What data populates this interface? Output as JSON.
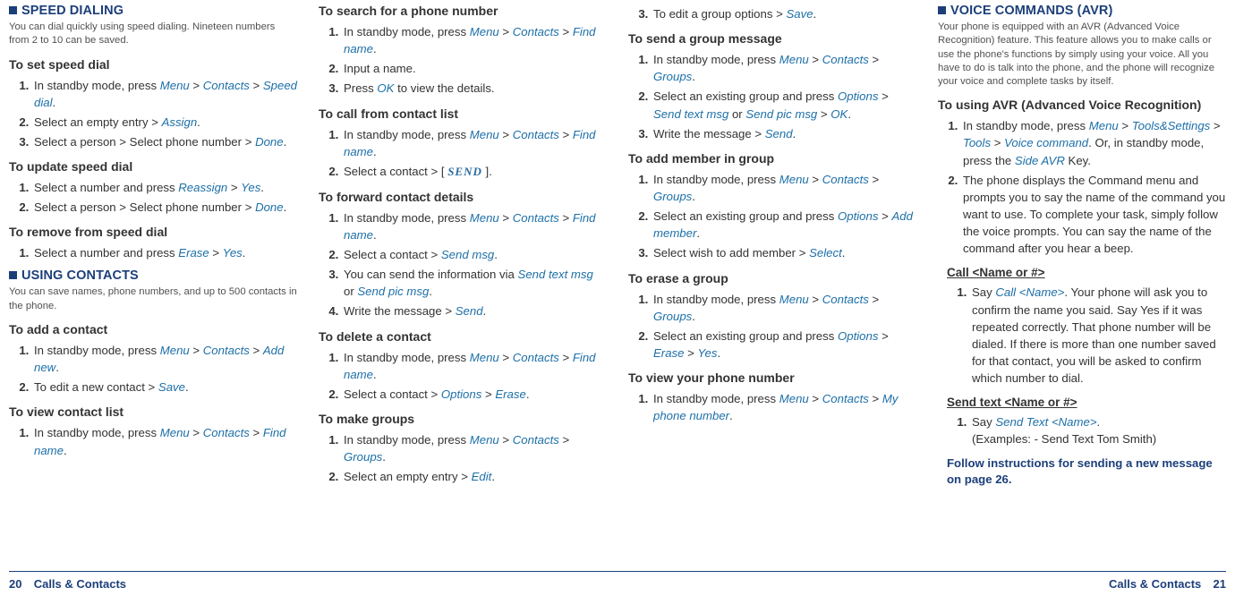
{
  "footer": {
    "left_page": "20",
    "right_page": "21",
    "section": "Calls & Contacts"
  },
  "col1": {
    "sec1": {
      "title": "SPEED DIALING",
      "desc": "You can dial quickly using speed dialing. Nineteen numbers from 2 to 10 can be saved.",
      "sub1": "To set speed dial",
      "li1a": "In standby mode, press ",
      "li1b": "Select an empty entry > ",
      "li1c": "Select a person > Select phone number > ",
      "sub2": "To update speed dial",
      "li2a": "Select a number and press ",
      "li2b": "Select a person > Select phone number > ",
      "sub3": "To remove from speed dial",
      "li3a": "Select a number and press "
    },
    "sec2": {
      "title": "USING CONTACTS",
      "desc": "You can save names, phone numbers, and up to 500 contacts in the phone.",
      "sub1": "To add a contact",
      "li1a": "In standby mode, press ",
      "li1b": "To edit a new contact > ",
      "sub2": "To view contact list",
      "li2a": "In standby mode, press "
    },
    "kw": {
      "menu": "Menu",
      "contacts": "Contacts",
      "speeddial": "Speed dial",
      "assign": "Assign",
      "done": "Done",
      "reassign": "Reassign",
      "yes": "Yes",
      "erase": "Erase",
      "addnew": "Add new",
      "save": "Save",
      "findname": "Find name"
    }
  },
  "col2": {
    "sub1": "To search for a phone number",
    "li1a": "In standby mode, press ",
    "li1b": "Input a name.",
    "li1c_a": "Press ",
    "li1c_b": " to view the details.",
    "sub2": "To call from contact list",
    "li2a": "In standby mode, press ",
    "li2b_a": "Select a contact > [ ",
    "li2b_b": " ].",
    "sub3": "To forward contact details",
    "li3a": "In standby mode, press ",
    "li3b": "Select a contact > ",
    "li3c_a": "You can send the information via ",
    "li3c_b": " or ",
    "li3d": "Write the message > ",
    "sub4": "To delete a contact",
    "li4a": "In standby mode, press ",
    "li4b": "Select a contact > ",
    "sub5": "To make groups",
    "li5a": "In standby mode, press ",
    "li5b": "Select an empty entry > ",
    "kw": {
      "menu": "Menu",
      "contacts": "Contacts",
      "findname": "Find name",
      "ok": "OK",
      "sendkey": "SEND",
      "sendmsg": "Send msg",
      "sendtextmsg": "Send text msg",
      "sendpicmsg": "Send pic msg",
      "send": "Send",
      "options": "Options",
      "erase": "Erase",
      "groups": "Groups",
      "edit": "Edit"
    }
  },
  "col3": {
    "li0": "To edit a group options > ",
    "sub1": "To send a group message",
    "li1a": "In standby mode, press ",
    "li1b_a": "Select an existing group and press ",
    "li1b_b": " or ",
    "li1b_c": " > ",
    "li1c": "Write the message > ",
    "sub2": "To add member in group",
    "li2a": "In standby mode, press ",
    "li2b": "Select an existing group and press ",
    "li2c": "Select wish to add member > ",
    "sub3": "To erase a group",
    "li3a": "In standby mode, press ",
    "li3b": "Select an existing group and press ",
    "sub4": "To view your phone number",
    "li4a": "In standby mode, press ",
    "kw": {
      "save": "Save",
      "menu": "Menu",
      "contacts": "Contacts",
      "groups": "Groups",
      "options": "Options",
      "sendtextmsg": "Send text msg",
      "sendpicmsg": "Send pic msg",
      "ok": "OK",
      "send": "Send",
      "addmember": "Add member",
      "select": "Select",
      "erase": "Erase",
      "yes": "Yes",
      "myphone": "My phone number"
    }
  },
  "col4": {
    "sec": {
      "title": "VOICE COMMANDS (AVR)",
      "desc": "Your phone is equipped with an AVR (Advanced Voice Recognition) feature. This feature allows you to make calls or use the phone's functions by simply using your voice. All you have to do is talk into the phone, and the phone will recognize your voice and complete tasks by itself."
    },
    "sub1": "To using AVR (Advanced Voice Recognition)",
    "li1a_a": "In standby mode, press ",
    "li1a_b": ". Or, in standby mode, press the ",
    "li1a_c": " Key.",
    "li1b": "The phone displays the Command menu and prompts you to say the name of the command you want to use. To complete your task, simply follow the voice prompts. You can say  the name of the command after you hear a beep.",
    "subU1": "Call <Name or #>",
    "liU1_a": "Say ",
    "liU1_b": ". Your phone will ask you to confirm the name you said. Say Yes if it was repeated correctly. That phone number will be dialed. If there is more than one number saved for that contact, you will be asked to confirm which number to dial.",
    "subU2": "Send text <Name or #>",
    "liU2_a": "Say ",
    "liU2_b": ".",
    "liU2_c": "(Examples: - Send Text Tom Smith)",
    "follow": "Follow instructions for sending a new message on page 26.",
    "kw": {
      "menu": "Menu",
      "tools_settings": "Tools&Settings",
      "tools": "Tools",
      "voicecmd": "Voice command",
      "sideavr": "Side AVR",
      "callname": "Call <Name>",
      "sendtextname": "Send Text <Name>"
    }
  }
}
